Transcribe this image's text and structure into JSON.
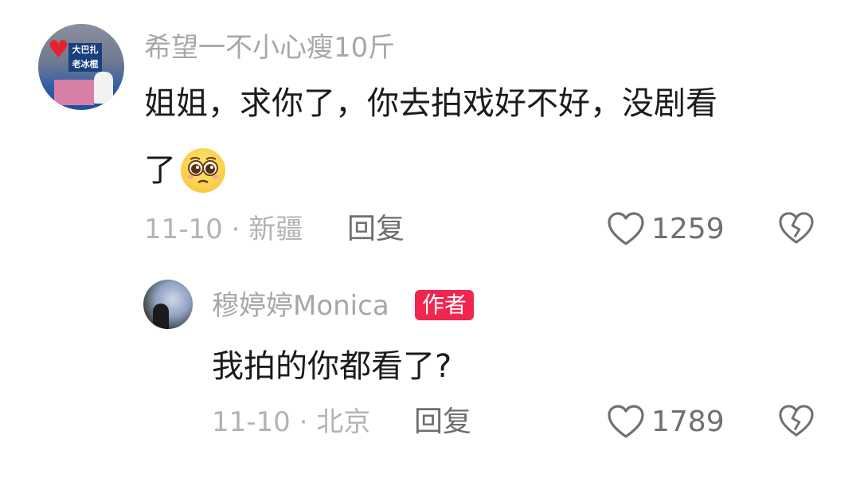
{
  "comments": [
    {
      "username": "希望一不小心瘦10斤",
      "text_line1": "姐姐，求你了，你去拍戏好不好，没剧看",
      "text_line2": "了",
      "emoji": "pleading-face-icon",
      "meta": "11-10 · 新疆",
      "reply_label": "回复",
      "like_count": "1259"
    }
  ],
  "reply": {
    "username": "穆婷婷Monica",
    "badge": "作者",
    "text": "我拍的你都看了?",
    "meta": "11-10 · 北京",
    "reply_label": "回复",
    "like_count": "1789"
  },
  "colors": {
    "badge_bg": "#f0264f",
    "username": "#a7a7a7",
    "text": "#1b1b1b",
    "meta": "#b3b3b3"
  }
}
